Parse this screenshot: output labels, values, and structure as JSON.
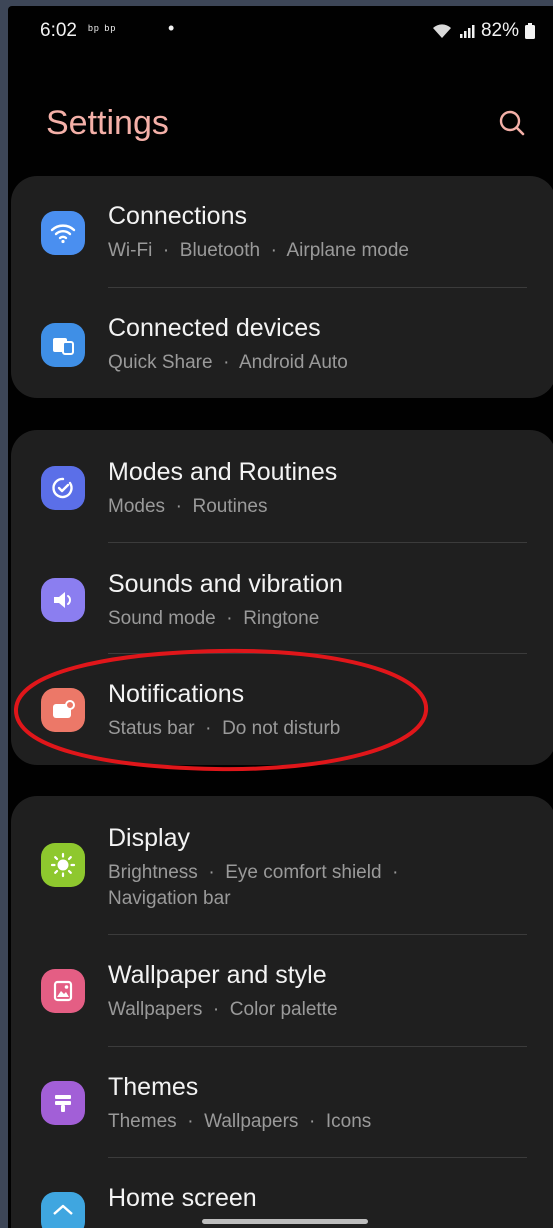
{
  "status_bar": {
    "time": "6:02",
    "left_icons": "ᵇᵖ ᵇᵖ",
    "dot": "•",
    "battery_percent": "82%"
  },
  "header": {
    "title": "Settings",
    "search_icon": "search-icon"
  },
  "groups": [
    {
      "items": [
        {
          "label": "Connections",
          "sub": [
            "Wi-Fi",
            "Bluetooth",
            "Airplane mode"
          ],
          "icon": "wifi-icon",
          "color": "#4a8ff0"
        },
        {
          "label": "Connected devices",
          "sub": [
            "Quick Share",
            "Android Auto"
          ],
          "icon": "devices-icon",
          "color": "#3f8fe6"
        }
      ]
    },
    {
      "items": [
        {
          "label": "Modes and Routines",
          "sub": [
            "Modes",
            "Routines"
          ],
          "icon": "routines-icon",
          "color": "#5b6fe8"
        },
        {
          "label": "Sounds and vibration",
          "sub": [
            "Sound mode",
            "Ringtone"
          ],
          "icon": "speaker-icon",
          "color": "#8b7ef0"
        },
        {
          "label": "Notifications",
          "sub": [
            "Status bar",
            "Do not disturb"
          ],
          "icon": "notification-icon",
          "color": "#ec7868"
        }
      ]
    },
    {
      "items": [
        {
          "label": "Display",
          "sub": [
            "Brightness",
            "Eye comfort shield",
            "Navigation bar"
          ],
          "icon": "brightness-icon",
          "color": "#8ec82e"
        },
        {
          "label": "Wallpaper and style",
          "sub": [
            "Wallpapers",
            "Color palette"
          ],
          "icon": "wallpaper-icon",
          "color": "#e45e84"
        },
        {
          "label": "Themes",
          "sub": [
            "Themes",
            "Wallpapers",
            "Icons"
          ],
          "icon": "themes-icon",
          "color": "#a25fd7"
        },
        {
          "label": "Home screen",
          "sub": [],
          "icon": "home-icon",
          "color": "#3fa6e0"
        }
      ]
    }
  ],
  "colors": {
    "title": "#f4b0a8",
    "background": "#010101",
    "card": "#1f1f1f",
    "annotation": "#e0161a"
  }
}
